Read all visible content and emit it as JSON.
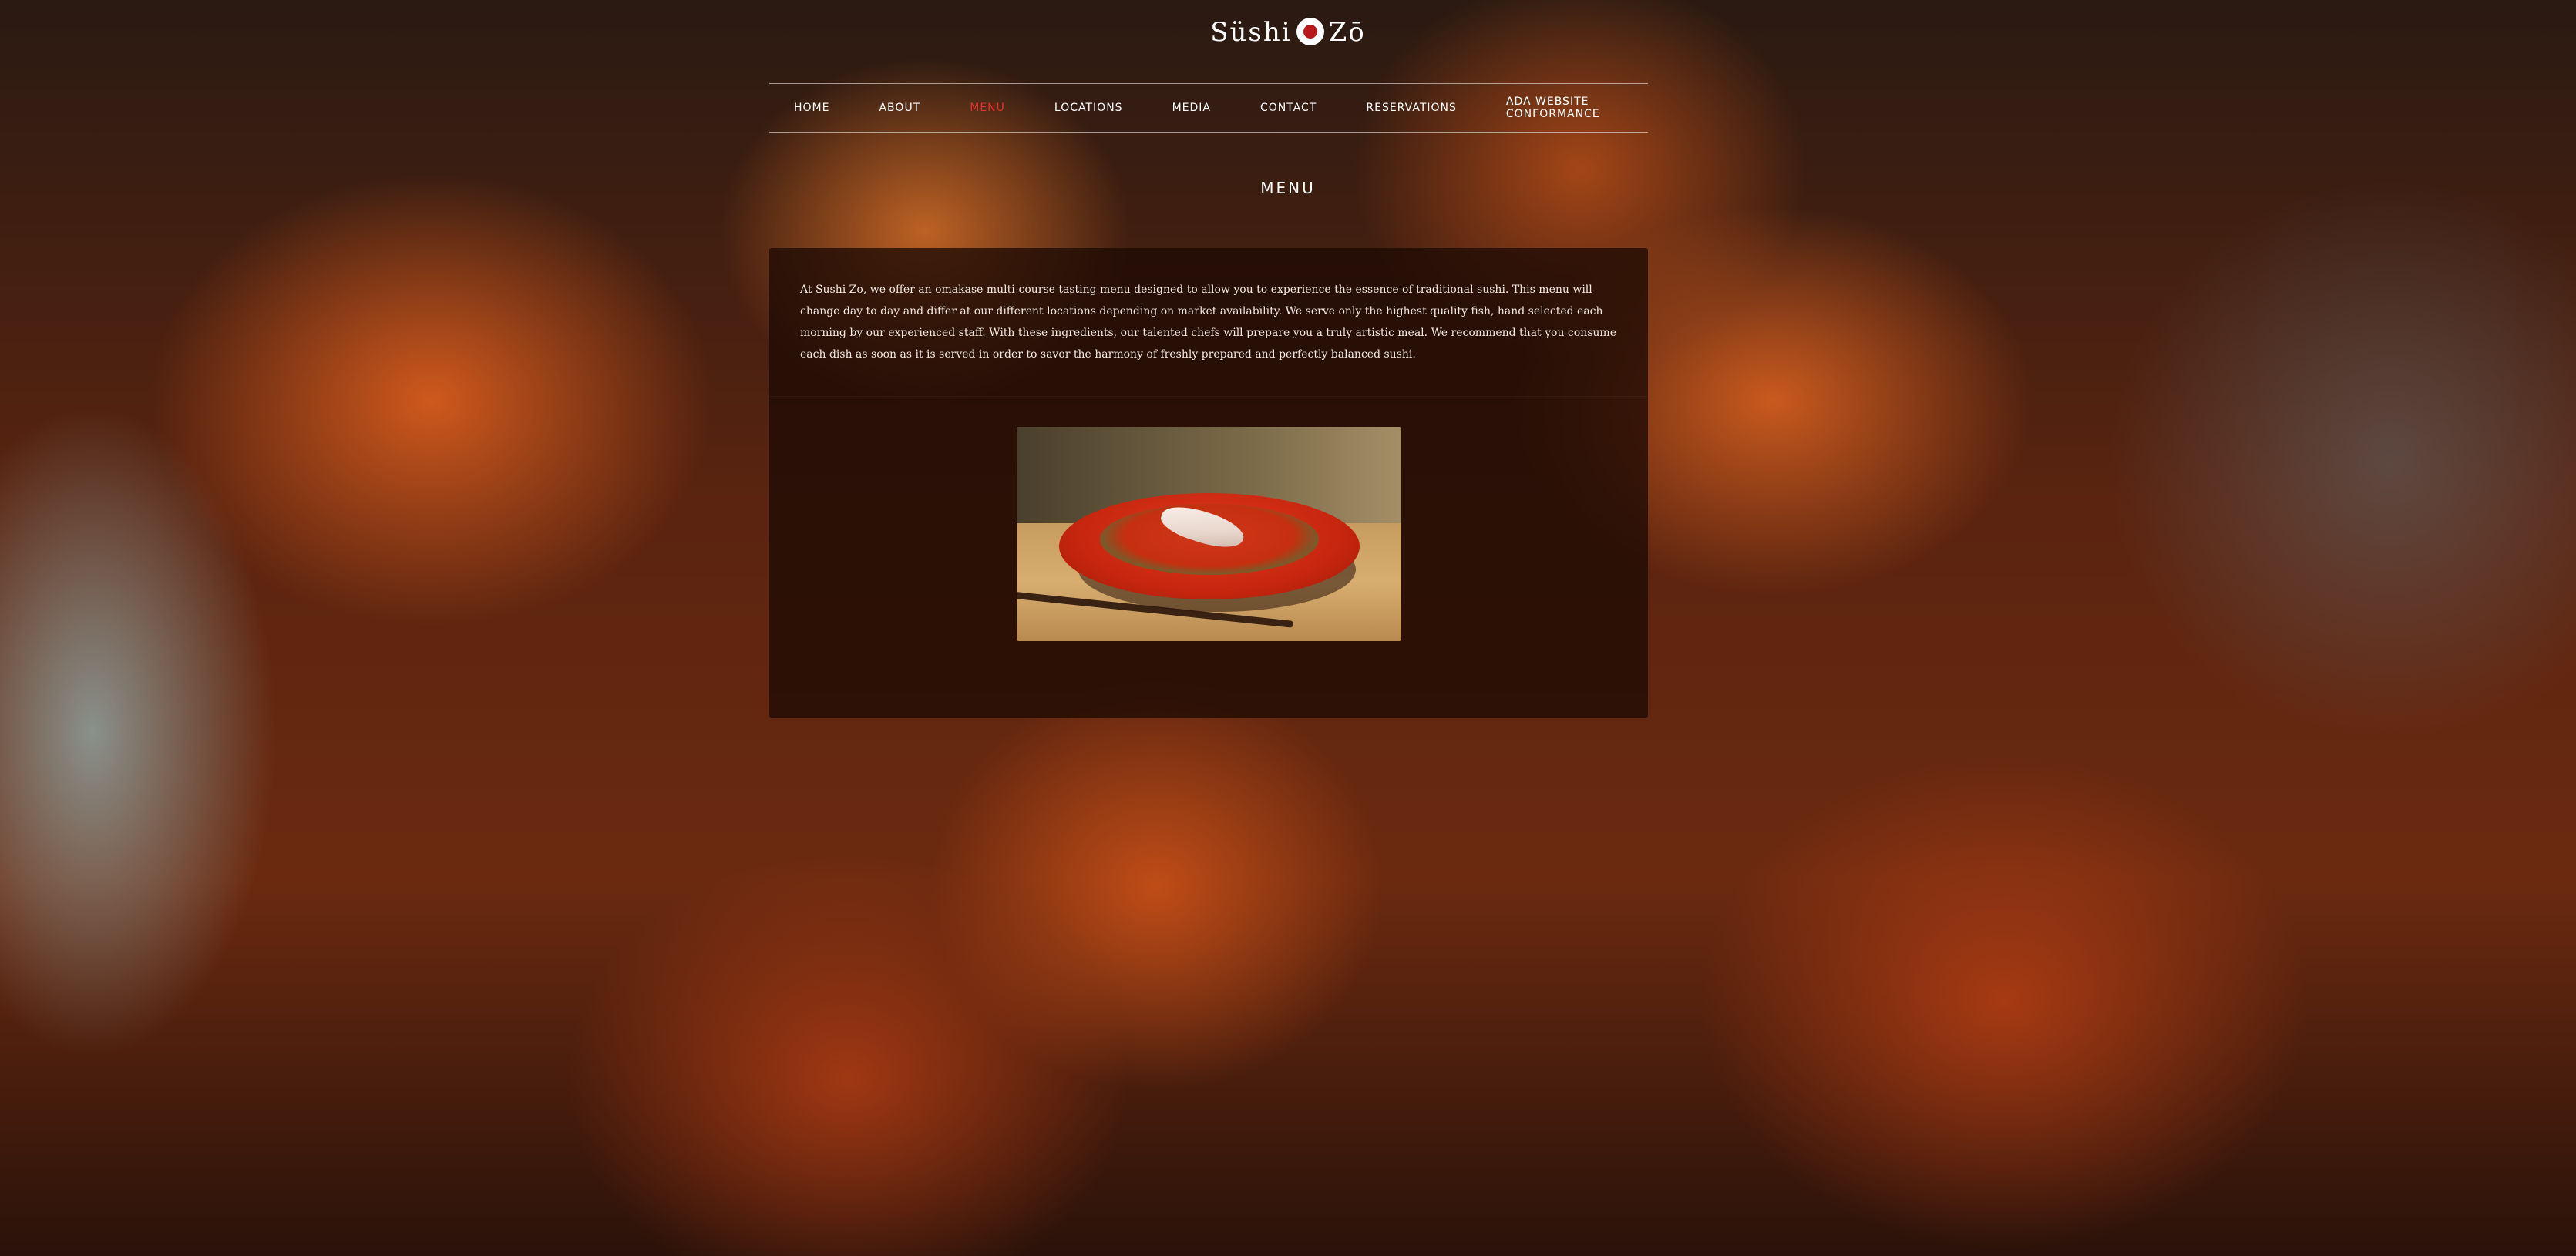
{
  "logo": {
    "left": "Süshi",
    "right": "Zō"
  },
  "nav": {
    "items": [
      {
        "label": "HOME",
        "active": false
      },
      {
        "label": "ABOUT",
        "active": false
      },
      {
        "label": "MENU",
        "active": true
      },
      {
        "label": "LOCATIONS",
        "active": false
      },
      {
        "label": "MEDIA",
        "active": false
      },
      {
        "label": "CONTACT",
        "active": false
      },
      {
        "label": "RESERVATIONS",
        "active": false
      },
      {
        "label": "ADA WEBSITE CONFORMANCE",
        "active": false
      }
    ],
    "active_color": "#e2322d"
  },
  "page": {
    "title": "MENU"
  },
  "content": {
    "intro": "At Sushi Zo, we offer an omakase multi-course tasting menu designed to allow you to experience the essence of traditional sushi. This menu will change day to day and differ at our different locations depending on market availability. We serve only the highest quality fish, hand selected each morning by our experienced staff. With these ingredients, our talented chefs will prepare you a truly artistic meal. We recommend that you consume each dish as soon as it is served in order to savor the harmony of freshly prepared and perfectly balanced sushi."
  },
  "icons": {
    "logo_mark": "logo-mark-icon"
  }
}
